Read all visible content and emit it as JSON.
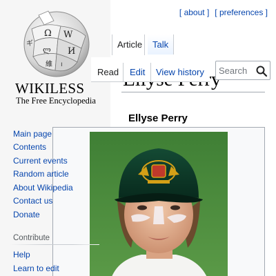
{
  "logo": {
    "wordmark": "WIKILESS",
    "tagline": "The Free Encyclopedia"
  },
  "personal_links": {
    "about": "[ about ]",
    "preferences": "[ preferences ]"
  },
  "namespace_tabs": {
    "article": "Article",
    "talk": "Talk"
  },
  "view_tabs": {
    "read": "Read",
    "edit": "Edit",
    "history": "View history"
  },
  "search": {
    "placeholder": "Search",
    "value": ""
  },
  "page": {
    "title": "Ellyse Perry",
    "infobox_title": "Ellyse Perry"
  },
  "sidebar": {
    "main_links": [
      "Main page",
      "Contents",
      "Current events",
      "Random article",
      "About Wikipedia",
      "Contact us",
      "Donate"
    ],
    "contribute_heading": "Contribute",
    "contribute_links": [
      "Help",
      "Learn to edit"
    ]
  },
  "colors": {
    "link": "#0645ad",
    "sidebar_bg": "#f6f6f6",
    "border": "#a2a9b1",
    "cap_green": "#0d3b2a",
    "cap_gold": "#d4a017",
    "field_green": "#4a8a3a"
  }
}
